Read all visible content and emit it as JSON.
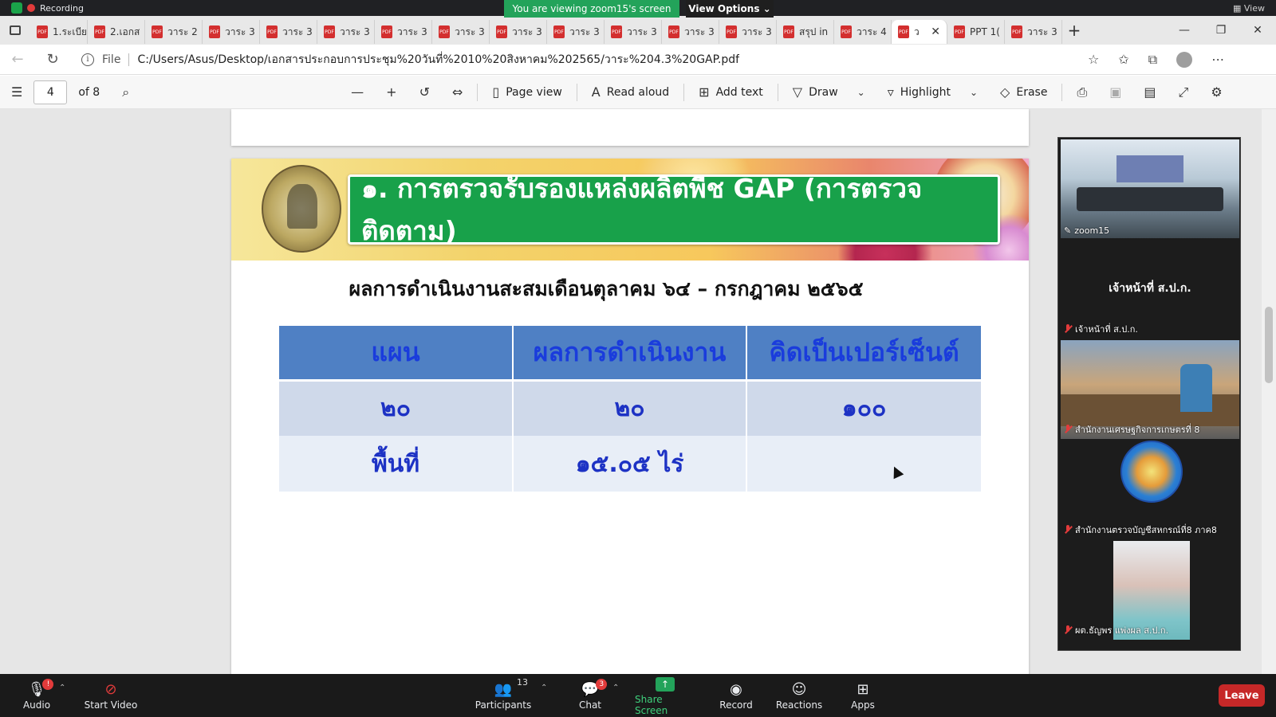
{
  "zoom_top": {
    "recording_label": "Recording",
    "viewing_text": "You are viewing zoom15's screen",
    "view_options_label": "View Options",
    "view_label": "View"
  },
  "browser": {
    "tabs": [
      {
        "label": "1.ระเบีย"
      },
      {
        "label": "2.เอกส"
      },
      {
        "label": "วาระ 2"
      },
      {
        "label": "วาระ 3"
      },
      {
        "label": "วาระ 3"
      },
      {
        "label": "วาระ 3"
      },
      {
        "label": "วาระ 3"
      },
      {
        "label": "วาระ 3"
      },
      {
        "label": "วาระ 3"
      },
      {
        "label": "วาระ 3"
      },
      {
        "label": "วาระ 3"
      },
      {
        "label": "วาระ 3"
      },
      {
        "label": "วาระ 3"
      },
      {
        "label": "สรุป in"
      },
      {
        "label": "วาระ 4"
      },
      {
        "label": "ว"
      },
      {
        "label": "PPT 1("
      },
      {
        "label": "วาระ 3"
      }
    ],
    "active_tab_index": 15,
    "address": {
      "scheme_label": "File",
      "url": "C:/Users/Asus/Desktop/เอกสารประกอบการประชุม%20วันที่%2010%20สิงหาคม%202565/วาระ%204.3%20GAP.pdf"
    }
  },
  "pdf_toolbar": {
    "page_current": "4",
    "page_total": "of 8",
    "page_view_label": "Page view",
    "read_aloud_label": "Read aloud",
    "add_text_label": "Add text",
    "draw_label": "Draw",
    "highlight_label": "Highlight",
    "erase_label": "Erase"
  },
  "slide": {
    "title": "๑. การตรวจรับรองแหล่งผลิตพืช GAP (การตรวจติดตาม)",
    "subtitle": "ผลการดำเนินงานสะสมเดือนตุลาคม ๖๔ – กรกฎาคม ๒๕๖๕",
    "table": {
      "headers": [
        "แผน",
        "ผลการดำเนินงาน",
        "คิดเป็นเปอร์เซ็นต์"
      ],
      "rows": [
        [
          "๒๐",
          "๒๐",
          "๑๐๐"
        ],
        [
          "พื้นที่",
          "๑๕.๐๕ ไร่",
          ""
        ]
      ]
    }
  },
  "participants_panel": {
    "tiles": [
      {
        "name": "zoom15"
      },
      {
        "name": "เจ้าหน้าที่ ส.ป.ก.",
        "caption": "เจ้าหน้าที่ ส.ป.ก."
      },
      {
        "name": "สำนักงานเศรษฐกิจการเกษตรที่ 8"
      },
      {
        "name": "สำนักงานตรวจบัญชีสหกรณ์ที่8 ภาค8"
      },
      {
        "name": "ผต.ธัญพร แพ่งผล ส.ป.ก."
      }
    ]
  },
  "zoom_bar": {
    "audio_label": "Audio",
    "audio_badge": "!",
    "video_label": "Start Video",
    "participants_label": "Participants",
    "participants_count": "13",
    "chat_label": "Chat",
    "chat_badge": "3",
    "share_label": "Share Screen",
    "record_label": "Record",
    "reactions_label": "Reactions",
    "apps_label": "Apps",
    "leave_label": "Leave"
  },
  "colors": {
    "title_green": "#18a14a",
    "table_header_blue": "#4f80c4",
    "table_text_blue": "#1d32c4",
    "zoom_share_green": "#23a35a",
    "leave_red": "#c62828"
  }
}
